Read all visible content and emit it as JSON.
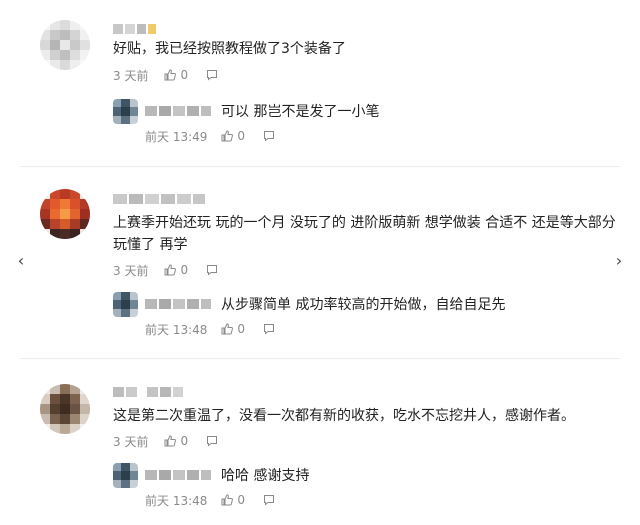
{
  "comments": [
    {
      "text": "好贴，我已经按照教程做了3个装备了",
      "time": "3 天前",
      "likes": "0",
      "reply": {
        "text": "可以 那岂不是发了一小笔",
        "time": "前天 13:49",
        "likes": "0"
      }
    },
    {
      "text_line1": "上赛季开始还玩 玩的一个月 没玩了的 进阶版萌新 想学做装 合适不 还是等大部分",
      "text_line2": "玩懂了 再学",
      "time": "3 天前",
      "likes": "0",
      "reply": {
        "text": "从步骤简单 成功率较高的开始做，自给自足先",
        "time": "前天 13:48",
        "likes": "0"
      }
    },
    {
      "text": "这是第二次重温了，没看一次都有新的收获，吃水不忘挖井人，感谢作者。",
      "time": "3 天前",
      "likes": "0",
      "reply": {
        "text": "哈哈 感谢支持",
        "time": "前天 13:48",
        "likes": "0"
      }
    }
  ],
  "icons": {
    "like": "thumbs-up-icon",
    "reply": "comment-bubble-icon",
    "prev": "chevron-left-icon",
    "next": "chevron-right-icon"
  },
  "nav": {
    "prev_glyph": "‹",
    "next_glyph": "›"
  }
}
